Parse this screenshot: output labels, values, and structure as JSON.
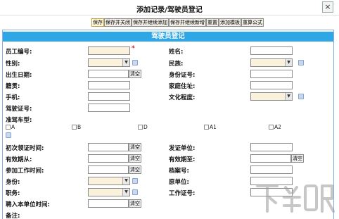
{
  "window": {
    "title": "添加记录/驾驶员登记",
    "close": "×"
  },
  "toolbar": [
    "保存",
    "保存并关闭",
    "保存并继续添加",
    "保存并继续新增",
    "重置",
    "添加模板",
    "重算公式"
  ],
  "form": {
    "header": "驾驶员登记",
    "clear_label": "清空",
    "labels": {
      "employee_no": "员工编号:",
      "name": "姓名:",
      "gender": "性别:",
      "ethnicity": "民族:",
      "birth_date": "出生日期:",
      "id_no": "身份证号:",
      "native_place": "籍贯:",
      "home_address": "家庭住址:",
      "phone": "手机:",
      "education": "文化程度:",
      "license_no": "驾驶证号:",
      "vehicle_type": "准驾车型:",
      "first_issue": "初次领证时间:",
      "issuing_unit": "发证单位:",
      "valid_from": "有效期从:",
      "valid_to": "有效期至:",
      "work_start": "参加工作时间:",
      "archive_no": "档案号:",
      "identity": "身份:",
      "original_unit": "原单位:",
      "position": "职务:",
      "work_id": "工作证号:",
      "hire_date": "聘入本单位时间:",
      "remark": "备注:"
    },
    "required_mark": "*",
    "vehicle_types": [
      "A",
      "B",
      "D",
      "A1",
      "A2"
    ]
  },
  "watermark": "下载吧"
}
